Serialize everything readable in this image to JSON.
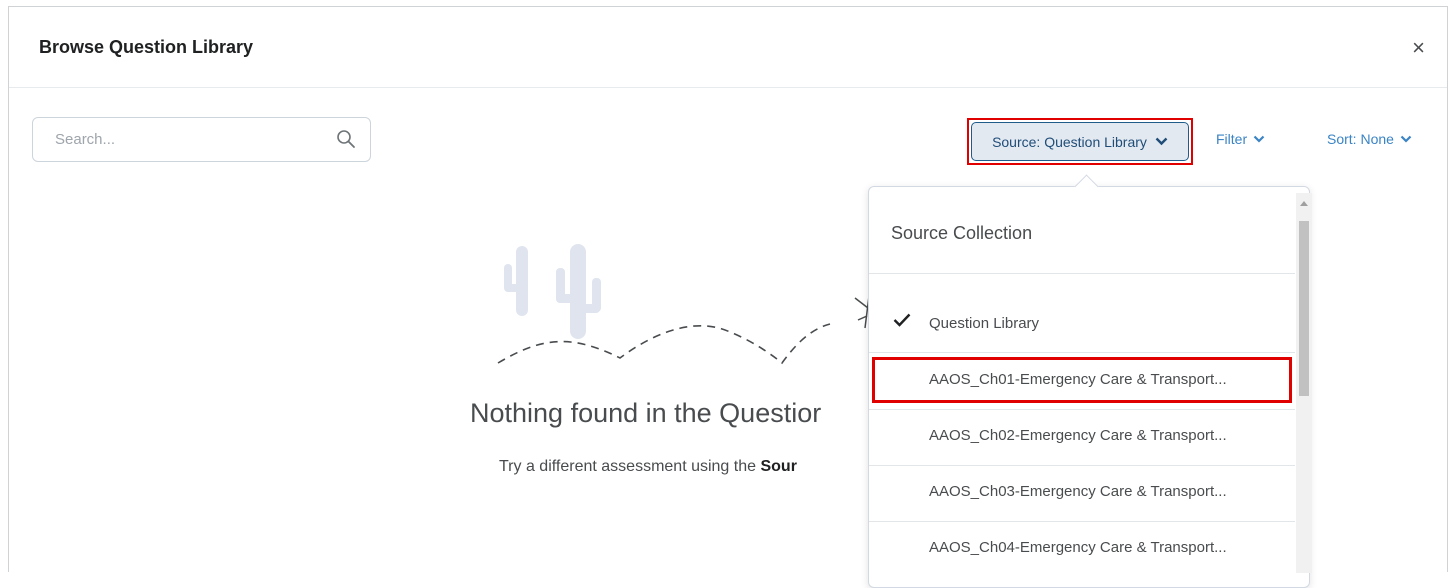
{
  "dialog": {
    "title": "Browse Question Library",
    "close_label": "×"
  },
  "search": {
    "placeholder": "Search..."
  },
  "toolbar": {
    "source_label": "Source: Question Library",
    "filter_label": "Filter",
    "sort_label": "Sort: None"
  },
  "empty_state": {
    "title": "Nothing found in the Questior",
    "subtitle_prefix": "Try a different assessment using the ",
    "subtitle_bold": "Sour"
  },
  "dropdown": {
    "heading": "Source Collection",
    "items": [
      {
        "label": "Question Library",
        "selected": true
      },
      {
        "label": "AAOS_Ch01-Emergency Care & Transport...",
        "selected": false
      },
      {
        "label": "AAOS_Ch02-Emergency Care & Transport...",
        "selected": false
      },
      {
        "label": "AAOS_Ch03-Emergency Care & Transport...",
        "selected": false
      },
      {
        "label": "AAOS_Ch04-Emergency Care & Transport...",
        "selected": false
      }
    ]
  },
  "colors": {
    "accent": "#3a84c6",
    "highlight": "#e00000",
    "source_bg": "#e3e9f1"
  },
  "icons": {
    "search": "search-icon",
    "check": "checkmark-icon",
    "chevron": "chevron-down-icon"
  }
}
